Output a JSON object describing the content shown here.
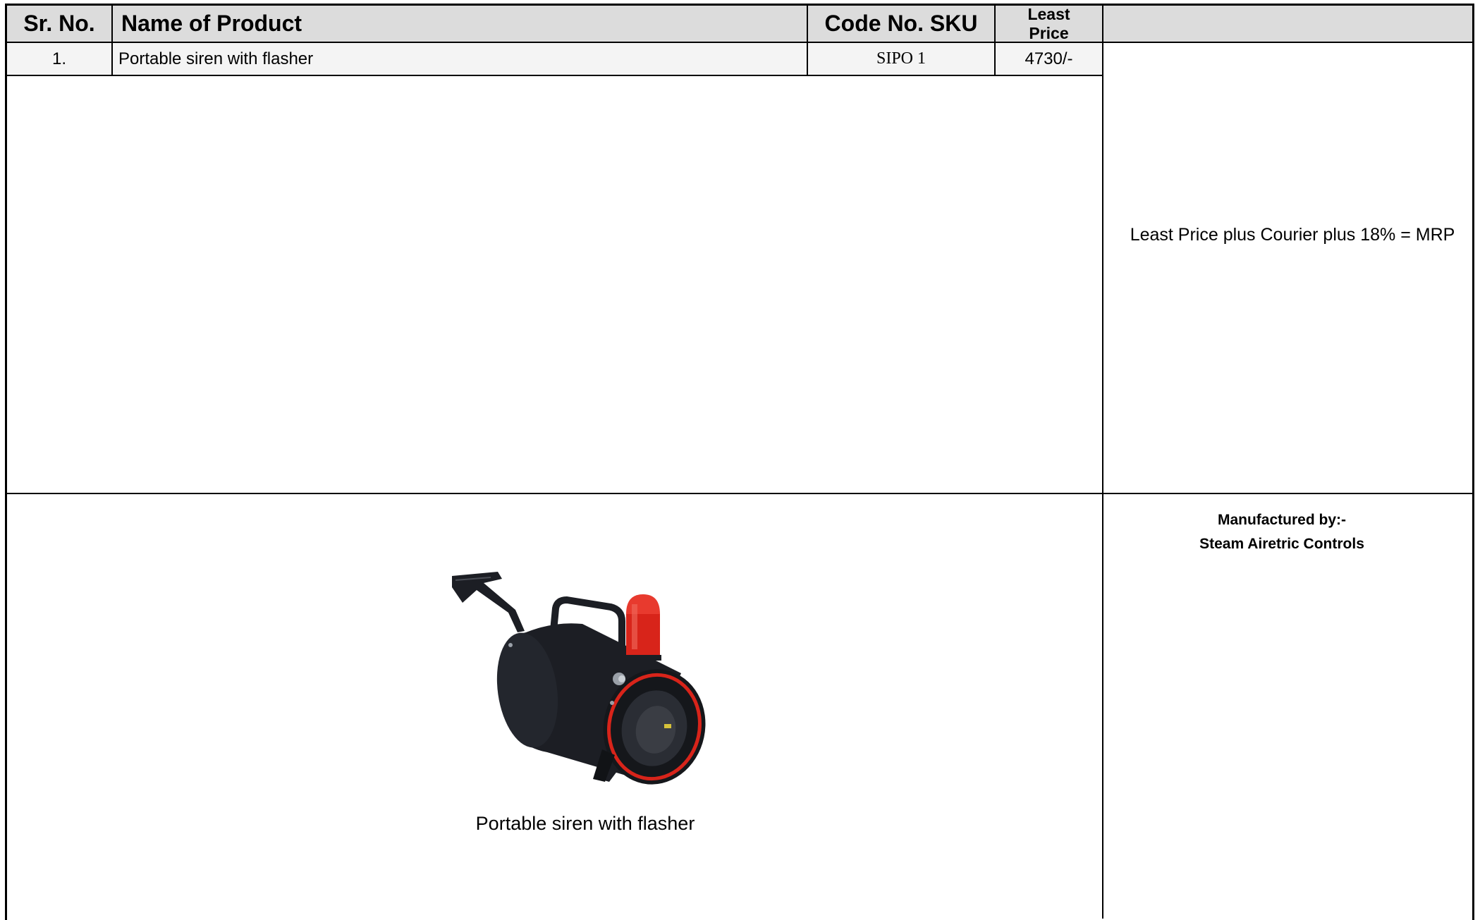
{
  "table": {
    "headers": {
      "sr_no": "Sr. No.",
      "name": "Name of Product",
      "code": "Code No. SKU",
      "price_line1": "Least",
      "price_line2": "Price",
      "extra": ""
    },
    "rows": [
      {
        "sr_no": "1.",
        "name": "Portable siren with flasher",
        "code": "SIPO 1",
        "price": "4730/-"
      }
    ]
  },
  "pricing_note": "Least Price plus Courier plus 18% = MRP",
  "product_image": {
    "caption": "Portable siren with flasher",
    "icon": "siren-image",
    "colors": {
      "body": "#1c1e24",
      "accent": "#d8241a"
    }
  },
  "manufacturer": {
    "label": "Manufactured by:-",
    "name": "Steam Airetric Controls"
  }
}
